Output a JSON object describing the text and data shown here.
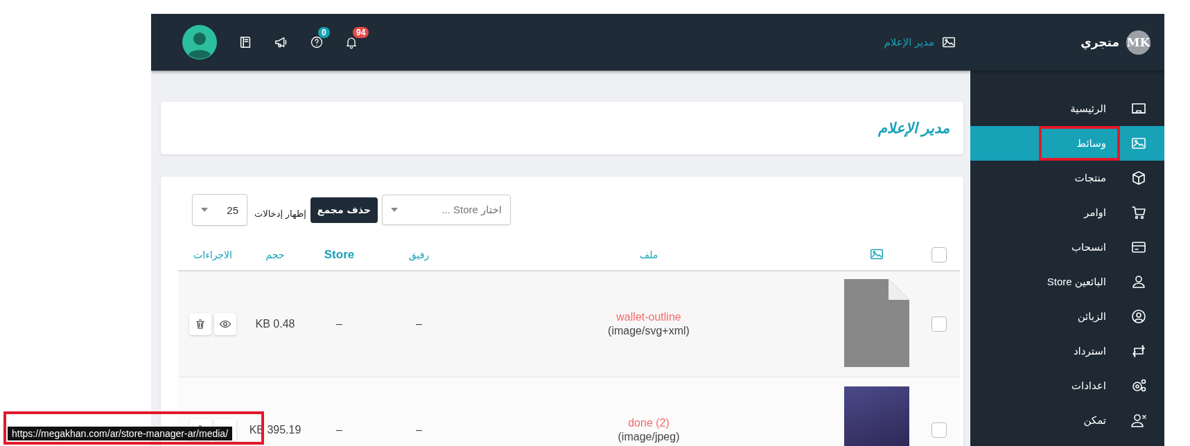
{
  "sidebar": {
    "brand": {
      "initials": "MK",
      "name": "متجري"
    },
    "items": [
      {
        "label": "الرئيسية",
        "selected": false
      },
      {
        "label": "وسائط",
        "selected": true
      },
      {
        "label": "منتجات",
        "selected": false
      },
      {
        "label": "اوامر",
        "selected": false
      },
      {
        "label": "انسحاب",
        "selected": false
      },
      {
        "label": "البائعين Store",
        "selected": false
      },
      {
        "label": "الزبائن",
        "selected": false
      },
      {
        "label": "استرداد",
        "selected": false
      },
      {
        "label": "اعدادات",
        "selected": false
      },
      {
        "label": "تمكن",
        "selected": false
      }
    ]
  },
  "topbar": {
    "breadcrumb": "مدير الإعلام",
    "notifications": "94",
    "help": "0"
  },
  "page_title": "مدير الإعلام",
  "toolbar": {
    "store_select": {
      "placeholder": "اختار Store ..."
    },
    "bulk_delete": "حذف مجمع",
    "entries_label": "إظهار إدخالات",
    "page_size": "25"
  },
  "table": {
    "header_checked": false,
    "columns": [
      "ملف",
      "رفيق",
      "Store",
      "حجم",
      "الاجراءات"
    ],
    "rows": [
      {
        "checked": false,
        "kind": "file",
        "name": "wallet-outline",
        "mime": "(image/svg+xml)",
        "companion": "–",
        "store": "–",
        "size": "KB 0.48"
      },
      {
        "checked": false,
        "kind": "photo",
        "name": "done (2)",
        "mime": "(image/jpeg)",
        "companion": "–",
        "store": "–",
        "size": "KB 395.19"
      }
    ]
  },
  "status_url": "https://megakhan.com/ar/store-manager-ar/media/"
}
